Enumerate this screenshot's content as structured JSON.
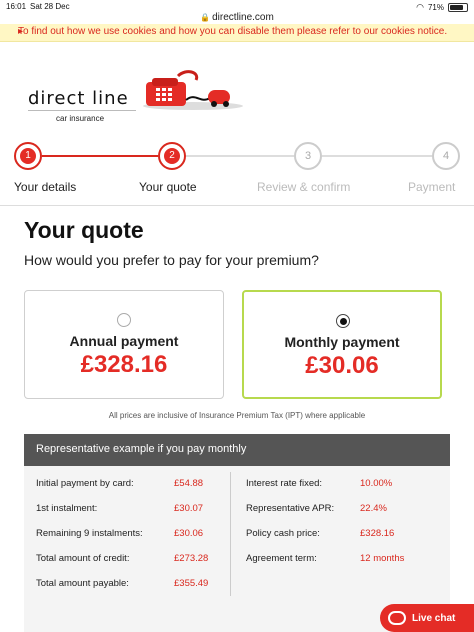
{
  "status": {
    "time": "16:01",
    "date": "Sat 28 Dec",
    "url": "directline.com",
    "battery": "71%",
    "battery_level": 0.71
  },
  "cookie_notice": {
    "text": "To find out how we use cookies and how you can disable them please refer to our cookies notice.",
    "arrow": "▸"
  },
  "logo": {
    "brand": "direct line",
    "subtitle": "car insurance"
  },
  "steps": [
    {
      "number": "1",
      "label": "Your details"
    },
    {
      "number": "2",
      "label": "Your quote"
    },
    {
      "number": "3",
      "label": "Review & confirm"
    },
    {
      "number": "4",
      "label": "Payment"
    }
  ],
  "heading": "Your quote",
  "question": "How would you prefer to pay for your premium?",
  "options": {
    "annual": {
      "title": "Annual payment",
      "price": "£328.16",
      "selected": false
    },
    "monthly": {
      "title": "Monthly payment",
      "price": "£30.06",
      "selected": true
    }
  },
  "ipt_note": "All prices are inclusive of Insurance Premium Tax (IPT) where applicable",
  "representative": {
    "heading": "Representative example if you pay monthly",
    "left": [
      {
        "label": "Initial payment by card:",
        "value": "£54.88"
      },
      {
        "label": "1st instalment:",
        "value": "£30.07"
      },
      {
        "label": "Remaining 9 instalments:",
        "value": "£30.06"
      },
      {
        "label": "Total amount of credit:",
        "value": "£273.28"
      },
      {
        "label": "Total amount payable:",
        "value": "£355.49"
      }
    ],
    "right": [
      {
        "label": "Interest rate fixed:",
        "value": "10.00%"
      },
      {
        "label": "Representative APR:",
        "value": "22.4%"
      },
      {
        "label": "Policy cash price:",
        "value": "£328.16"
      },
      {
        "label": "Agreement term:",
        "value": "12 months"
      }
    ]
  },
  "live_chat": {
    "label": "Live chat"
  },
  "colors": {
    "brand_red": "#e42c26",
    "selected_border": "#b7d94e",
    "rep_header": "#555555"
  }
}
